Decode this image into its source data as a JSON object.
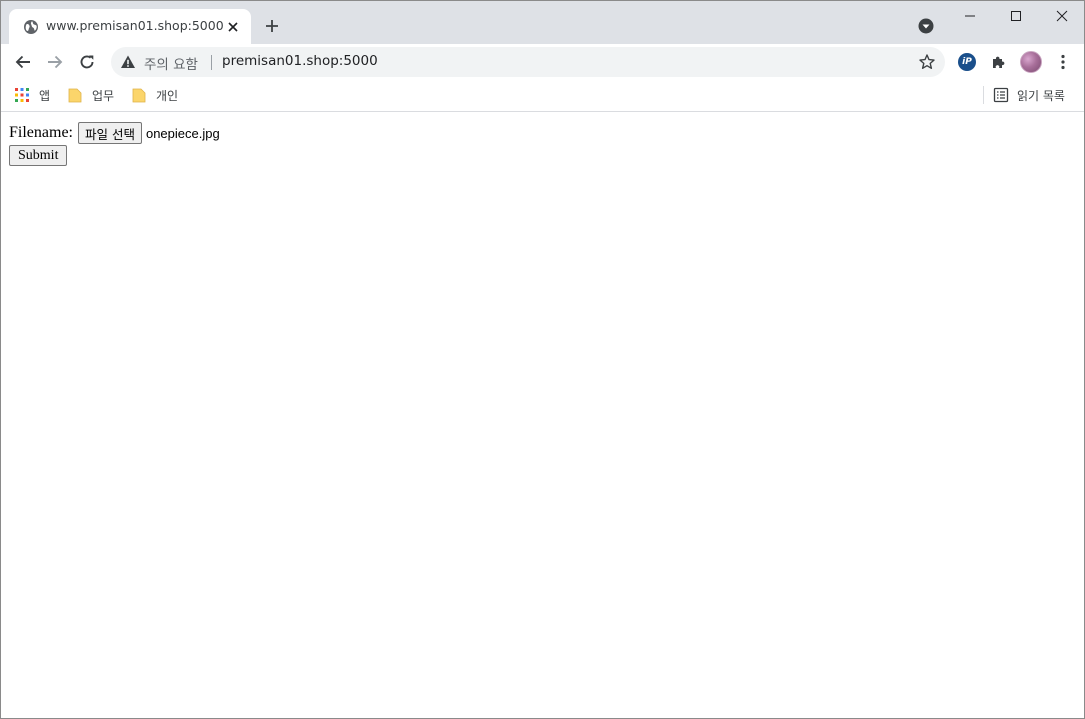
{
  "browser": {
    "tab": {
      "title": "www.premisan01.shop:5000",
      "icon": "globe-icon"
    },
    "address_bar": {
      "security_label": "주의 요함",
      "url": "premisan01.shop:5000"
    },
    "bookmarks": {
      "items": [
        {
          "label": "앱",
          "icon": "apps-grid-icon"
        },
        {
          "label": "업무",
          "icon": "folder-icon"
        },
        {
          "label": "개인",
          "icon": "folder-icon"
        }
      ],
      "reading_list": {
        "label": "읽기 목록",
        "icon": "reading-list-icon"
      }
    }
  },
  "page": {
    "form": {
      "file_label": "Filename:",
      "file_button": "파일 선택",
      "file_name": "onepiece.jpg",
      "submit_label": "Submit"
    }
  },
  "colors": {
    "tabstrip": "#dee1e6",
    "omnibox": "#f1f3f4",
    "folder": "#fbd56b"
  }
}
